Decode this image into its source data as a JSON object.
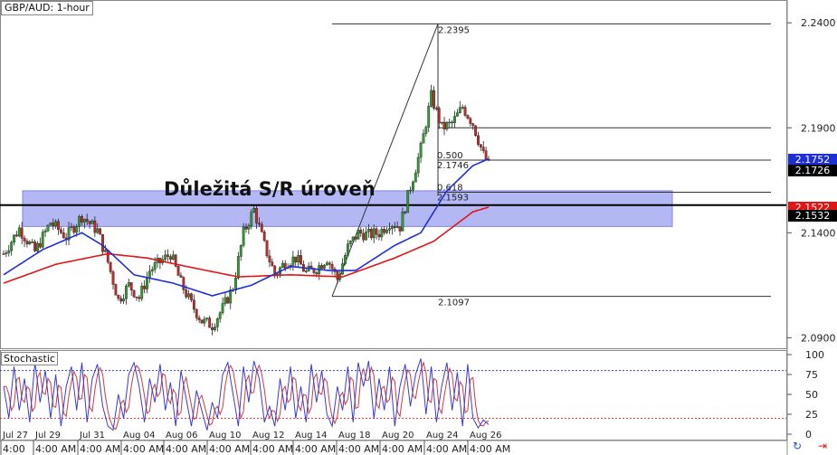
{
  "chart_title": "GBP/AUD: 1-hour",
  "annotation": "Důležitá S/R úroveň",
  "stochastic_label": "Stochastic",
  "colors": {
    "candle_up": "#2e9e2e",
    "candle_down": "#c62828",
    "ma_fast": "#1f2fd6",
    "ma_slow": "#e01515",
    "sr_zone": "#9aa0f0",
    "stoch_k": "#3b3bd0",
    "stoch_d": "#d03b3b",
    "price_tag_blue": "#1f2fd6",
    "price_tag_red": "#e01515",
    "price_tag_dark": "#000000"
  },
  "price_tags": [
    {
      "name": "ma-fast-tag",
      "value": "2.1752",
      "color": "#1f2fd6"
    },
    {
      "name": "current-price-tag",
      "value": "2.1726",
      "color": "#000000"
    },
    {
      "name": "ma-slow-tag",
      "value": "2.1522",
      "color": "#e01515"
    },
    {
      "name": "sr-level-tag",
      "value": "2.1532",
      "color": "#000000"
    }
  ],
  "icons": [
    "sync-icon",
    "arrow-right-icon"
  ],
  "chart_data": [
    {
      "type": "candlestick",
      "title": "GBP/AUD: 1-hour",
      "ylim": [
        2.085,
        2.25
      ],
      "y_ticks": [
        "2.2400",
        "2.1900",
        "2.1400",
        "2.0900"
      ],
      "x_ticks": [
        "Jul 27",
        "Jul 29",
        "Jul 31",
        "Aug 04",
        "Aug 06",
        "Aug 10",
        "Aug 12",
        "Aug 14",
        "Aug 18",
        "Aug 20",
        "Aug 24",
        "Aug 26"
      ],
      "x_tick_sub": [
        "4:00",
        "4:00 AM",
        "4:00 AM",
        "4:00 AM",
        "4:00 AM",
        "4:00 AM",
        "4:00 AM",
        "4:00 AM",
        "4:00 AM",
        "4:00 AM",
        "4:00 AM",
        "4:00 AM"
      ],
      "close_path": [
        [
          0,
          2.13
        ],
        [
          6,
          2.142
        ],
        [
          12,
          2.131
        ],
        [
          18,
          2.145
        ],
        [
          24,
          2.138
        ],
        [
          30,
          2.148
        ],
        [
          36,
          2.141
        ],
        [
          40,
          2.126
        ],
        [
          44,
          2.108
        ],
        [
          48,
          2.115
        ],
        [
          52,
          2.109
        ],
        [
          56,
          2.122
        ],
        [
          60,
          2.126
        ],
        [
          64,
          2.13
        ],
        [
          68,
          2.116
        ],
        [
          72,
          2.106
        ],
        [
          76,
          2.098
        ],
        [
          80,
          2.096
        ],
        [
          84,
          2.104
        ],
        [
          88,
          2.114
        ],
        [
          92,
          2.14
        ],
        [
          96,
          2.151
        ],
        [
          100,
          2.134
        ],
        [
          104,
          2.12
        ],
        [
          108,
          2.126
        ],
        [
          112,
          2.128
        ],
        [
          116,
          2.121
        ],
        [
          120,
          2.123
        ],
        [
          124,
          2.128
        ],
        [
          128,
          2.118
        ],
        [
          132,
          2.133
        ],
        [
          136,
          2.14
        ],
        [
          140,
          2.139
        ],
        [
          144,
          2.14
        ],
        [
          148,
          2.145
        ],
        [
          152,
          2.143
        ],
        [
          156,
          2.162
        ],
        [
          160,
          2.18
        ],
        [
          164,
          2.205
        ],
        [
          168,
          2.19
        ],
        [
          172,
          2.192
        ],
        [
          176,
          2.2
        ],
        [
          180,
          2.192
        ],
        [
          184,
          2.177
        ],
        [
          186,
          2.1726
        ]
      ],
      "ma_fast_path": [
        [
          0,
          2.12
        ],
        [
          15,
          2.132
        ],
        [
          30,
          2.14
        ],
        [
          38,
          2.134
        ],
        [
          50,
          2.12
        ],
        [
          65,
          2.116
        ],
        [
          80,
          2.11
        ],
        [
          95,
          2.115
        ],
        [
          110,
          2.124
        ],
        [
          125,
          2.122
        ],
        [
          135,
          2.122
        ],
        [
          150,
          2.134
        ],
        [
          160,
          2.14
        ],
        [
          170,
          2.16
        ],
        [
          180,
          2.172
        ],
        [
          186,
          2.1752
        ]
      ],
      "ma_slow_path": [
        [
          0,
          2.116
        ],
        [
          20,
          2.125
        ],
        [
          40,
          2.13
        ],
        [
          55,
          2.128
        ],
        [
          70,
          2.124
        ],
        [
          90,
          2.119
        ],
        [
          110,
          2.12
        ],
        [
          130,
          2.119
        ],
        [
          150,
          2.128
        ],
        [
          165,
          2.136
        ],
        [
          180,
          2.15
        ],
        [
          186,
          2.1522
        ]
      ],
      "fibonacci": {
        "high": "2.2395",
        "low": "2.1097",
        "levels": [
          {
            "ratio": "0.500",
            "price": "2.1746",
            "value": 2.1746
          },
          {
            "ratio": "0.618",
            "price": "2.1593",
            "value": 2.1593
          }
        ],
        "high_value": 2.2395,
        "low_value": 2.1097,
        "mid_value": 2.19
      },
      "sr_level": 2.1532,
      "sr_zone": [
        2.143,
        2.16
      ]
    },
    {
      "type": "line",
      "title": "Stochastic",
      "ylim": [
        0,
        100
      ],
      "y_ticks": [
        "100",
        "75",
        "50",
        "25",
        "0"
      ],
      "bands": [
        20,
        80
      ],
      "k_path": [
        [
          0,
          60
        ],
        [
          2,
          20
        ],
        [
          4,
          85
        ],
        [
          6,
          30
        ],
        [
          8,
          70
        ],
        [
          10,
          15
        ],
        [
          12,
          90
        ],
        [
          14,
          40
        ],
        [
          16,
          80
        ],
        [
          18,
          20
        ],
        [
          20,
          75
        ],
        [
          22,
          10
        ],
        [
          24,
          60
        ],
        [
          26,
          85
        ],
        [
          28,
          30
        ],
        [
          30,
          90
        ],
        [
          32,
          15
        ],
        [
          34,
          70
        ],
        [
          36,
          88
        ],
        [
          38,
          35
        ],
        [
          40,
          10
        ],
        [
          42,
          5
        ],
        [
          44,
          50
        ],
        [
          46,
          20
        ],
        [
          48,
          75
        ],
        [
          50,
          90
        ],
        [
          52,
          60
        ],
        [
          54,
          15
        ],
        [
          56,
          70
        ],
        [
          58,
          40
        ],
        [
          60,
          88
        ],
        [
          62,
          30
        ],
        [
          64,
          65
        ],
        [
          66,
          10
        ],
        [
          68,
          80
        ],
        [
          70,
          45
        ],
        [
          72,
          10
        ],
        [
          74,
          55
        ],
        [
          76,
          30
        ],
        [
          78,
          5
        ],
        [
          80,
          40
        ],
        [
          82,
          20
        ],
        [
          84,
          75
        ],
        [
          86,
          90
        ],
        [
          88,
          50
        ],
        [
          90,
          10
        ],
        [
          92,
          85
        ],
        [
          94,
          40
        ],
        [
          96,
          92
        ],
        [
          98,
          70
        ],
        [
          100,
          15
        ],
        [
          102,
          35
        ],
        [
          104,
          10
        ],
        [
          106,
          70
        ],
        [
          108,
          30
        ],
        [
          110,
          85
        ],
        [
          112,
          20
        ],
        [
          114,
          60
        ],
        [
          116,
          15
        ],
        [
          118,
          88
        ],
        [
          120,
          40
        ],
        [
          122,
          80
        ],
        [
          124,
          25
        ],
        [
          126,
          10
        ],
        [
          128,
          60
        ],
        [
          130,
          30
        ],
        [
          132,
          85
        ],
        [
          134,
          15
        ],
        [
          136,
          90
        ],
        [
          138,
          60
        ],
        [
          140,
          92
        ],
        [
          142,
          20
        ],
        [
          144,
          70
        ],
        [
          146,
          30
        ],
        [
          148,
          85
        ],
        [
          150,
          10
        ],
        [
          152,
          60
        ],
        [
          154,
          88
        ],
        [
          156,
          35
        ],
        [
          158,
          75
        ],
        [
          160,
          95
        ],
        [
          162,
          25
        ],
        [
          164,
          85
        ],
        [
          166,
          15
        ],
        [
          168,
          60
        ],
        [
          170,
          90
        ],
        [
          172,
          30
        ],
        [
          174,
          78
        ],
        [
          176,
          10
        ],
        [
          178,
          88
        ],
        [
          180,
          20
        ],
        [
          182,
          8
        ],
        [
          184,
          18
        ],
        [
          186,
          12
        ]
      ]
    }
  ]
}
